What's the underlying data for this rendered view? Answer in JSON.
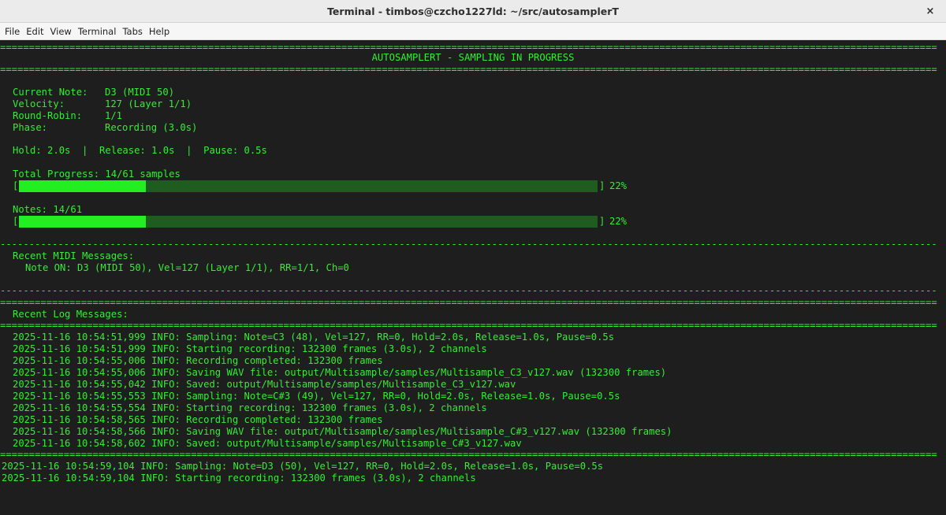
{
  "window": {
    "title": "Terminal - timbos@czcho1227ld: ~/src/autosamplerT",
    "close_glyph": "×"
  },
  "menu": [
    "File",
    "Edit",
    "View",
    "Terminal",
    "Tabs",
    "Help"
  ],
  "header": {
    "title": "AUTOSAMPLERT - SAMPLING IN PROGRESS"
  },
  "status": {
    "current_note_label": "Current Note:",
    "current_note_value": "D3 (MIDI 50)",
    "velocity_label": "Velocity:",
    "velocity_value": "127 (Layer 1/1)",
    "round_robin_label": "Round-Robin:",
    "round_robin_value": "1/1",
    "phase_label": "Phase:",
    "phase_value": "Recording (3.0s)",
    "timing": "Hold: 2.0s  |  Release: 1.0s  |  Pause: 0.5s"
  },
  "progress": {
    "total_label": "Total Progress: 14/61 samples",
    "total_fraction": 0.22,
    "total_percent": "22%",
    "notes_label": "Notes: 14/61",
    "notes_fraction": 0.22,
    "notes_percent": "22%",
    "open_bracket": "[",
    "close_bracket": "]"
  },
  "midi": {
    "heading": "Recent MIDI Messages:",
    "messages": [
      "Note ON: D3 (MIDI 50), Vel=127 (Layer 1/1), RR=1/1, Ch=0"
    ]
  },
  "log": {
    "heading": "Recent Log Messages:",
    "messages": [
      "2025-11-16 10:54:51,999 INFO: Sampling: Note=C3 (48), Vel=127, RR=0, Hold=2.0s, Release=1.0s, Pause=0.5s",
      "2025-11-16 10:54:51,999 INFO: Starting recording: 132300 frames (3.0s), 2 channels",
      "2025-11-16 10:54:55,006 INFO: Recording completed: 132300 frames",
      "2025-11-16 10:54:55,006 INFO: Saving WAV file: output/Multisample/samples/Multisample_C3_v127.wav (132300 frames)",
      "2025-11-16 10:54:55,042 INFO: Saved: output/Multisample/samples/Multisample_C3_v127.wav",
      "2025-11-16 10:54:55,553 INFO: Sampling: Note=C#3 (49), Vel=127, RR=0, Hold=2.0s, Release=1.0s, Pause=0.5s",
      "2025-11-16 10:54:55,554 INFO: Starting recording: 132300 frames (3.0s), 2 channels",
      "2025-11-16 10:54:58,565 INFO: Recording completed: 132300 frames",
      "2025-11-16 10:54:58,566 INFO: Saving WAV file: output/Multisample/samples/Multisample_C#3_v127.wav (132300 frames)",
      "2025-11-16 10:54:58,602 INFO: Saved: output/Multisample/samples/Multisample_C#3_v127.wav"
    ]
  },
  "raw_output": [
    "2025-11-16 10:54:59,104 INFO: Sampling: Note=D3 (50), Vel=127, RR=0, Hold=2.0s, Release=1.0s, Pause=0.5s",
    "2025-11-16 10:54:59,104 INFO: Starting recording: 132300 frames (3.0s), 2 channels"
  ],
  "rules": {
    "double": "==================================================================================================================================================================",
    "dashed": "------------------------------------------------------------------------------------------------------------------------------------------------------------------"
  },
  "colors": {
    "terminal_bg": "#1e1e1e",
    "terminal_fg": "#33ee33",
    "bar_fill": "#22ee22",
    "bar_track": "#1f5c1f"
  }
}
